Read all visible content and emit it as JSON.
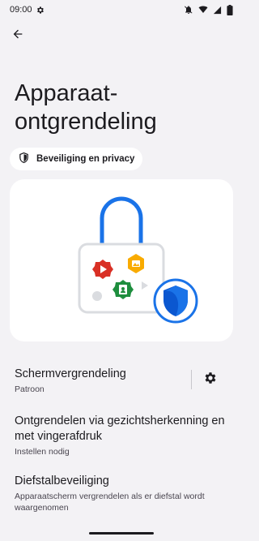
{
  "status": {
    "time": "09:00"
  },
  "page": {
    "title": "Apparaat-ontgrendeling"
  },
  "chip": {
    "label": "Beveiliging en privacy"
  },
  "items": [
    {
      "title": "Schermvergrendeling",
      "subtitle": "Patroon"
    },
    {
      "title": "Ontgrendelen via gezichtsherkenning en met vingerafdruk",
      "subtitle": "Instellen nodig"
    },
    {
      "title": "Diefstalbeveiliging",
      "subtitle": "Apparaatscherm vergrendelen als er diefstal wordt waargenomen"
    }
  ],
  "colors": {
    "background": "#f3f2f5",
    "card": "#ffffff",
    "accent_blue": "#1a73e8",
    "shield_dark": "#0b57d0",
    "red": "#d93025",
    "yellow": "#f9ab00",
    "green": "#1e8e3e"
  },
  "icons": [
    "gear-icon",
    "mute-icon",
    "wifi-icon",
    "signal-icon",
    "battery-icon",
    "back-arrow-icon",
    "shield-icon",
    "settings-gear-icon"
  ]
}
